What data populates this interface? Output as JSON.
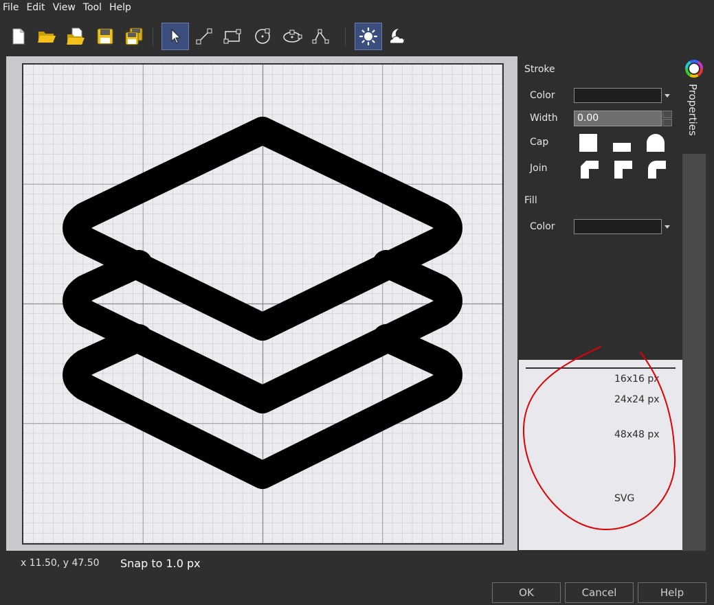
{
  "menu": [
    "File",
    "Edit",
    "View",
    "Tool",
    "Help"
  ],
  "toolbar": {
    "tools": [
      {
        "name": "new-file-icon",
        "active": false
      },
      {
        "name": "open-folder-icon",
        "active": false
      },
      {
        "name": "import-icon",
        "active": false
      },
      {
        "name": "save-icon",
        "active": false
      },
      {
        "name": "save-as-icon",
        "active": false
      },
      {
        "name": "select-arrow-icon",
        "active": true
      },
      {
        "name": "line-tool-icon",
        "active": false
      },
      {
        "name": "rectangle-tool-icon",
        "active": false
      },
      {
        "name": "circle-tool-icon",
        "active": false
      },
      {
        "name": "ellipse-tool-icon",
        "active": false
      },
      {
        "name": "path-tool-icon",
        "active": false
      },
      {
        "name": "light-theme-icon",
        "active": true
      },
      {
        "name": "dark-theme-icon",
        "active": false
      }
    ]
  },
  "properties": {
    "stroke_header": "Stroke",
    "color_label": "Color",
    "width_label": "Width",
    "width_value": "0.00",
    "cap_label": "Cap",
    "join_label": "Join",
    "fill_header": "Fill",
    "fill_color_label": "Color",
    "stroke_color": "#1e1e1e",
    "fill_color": "#1e1e1e"
  },
  "preview": {
    "sizes": [
      "16x16 px",
      "24x24 px",
      "48x48 px",
      "SVG"
    ]
  },
  "sidetab": {
    "label": "Properties"
  },
  "status": {
    "coords": "x 11.50, y 47.50",
    "snap": "Snap to 1.0 px"
  },
  "buttons": {
    "ok": "OK",
    "cancel": "Cancel",
    "help": "Help"
  },
  "colors": {
    "accent": "#3b4e7e",
    "annotation": "#e00000"
  }
}
